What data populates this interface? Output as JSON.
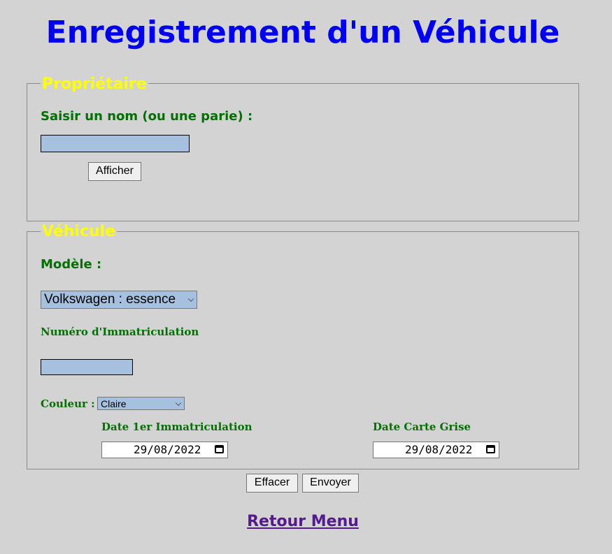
{
  "page": {
    "title": "Enregistrement d'un Véhicule"
  },
  "proprietaire": {
    "legend": "Propriétaire",
    "name_label": "Saisir un nom (ou une parie) :",
    "name_value": "",
    "display_button": "Afficher"
  },
  "vehicule": {
    "legend": "Véhicule",
    "model_label": "Modèle :",
    "model_selected": "Volkswagen : essence",
    "plate_label": "Numéro d'Immatriculation",
    "plate_value": "",
    "color_label": "Couleur :",
    "color_selected": "Claire",
    "first_registration_label": "Date 1er Immatriculation",
    "first_registration_value": "29/08/2022",
    "registration_card_label": "Date Carte Grise",
    "registration_card_value": "29/08/2022"
  },
  "actions": {
    "clear_button": "Effacer",
    "submit_button": "Envoyer"
  },
  "footer": {
    "back_link": "Retour Menu"
  },
  "colors": {
    "background": "#d3d3d3",
    "title": "#0000ee",
    "legend": "#ffff00",
    "label": "#007000",
    "input_fill": "#a6c0e0",
    "visited_link": "#551a8b"
  }
}
